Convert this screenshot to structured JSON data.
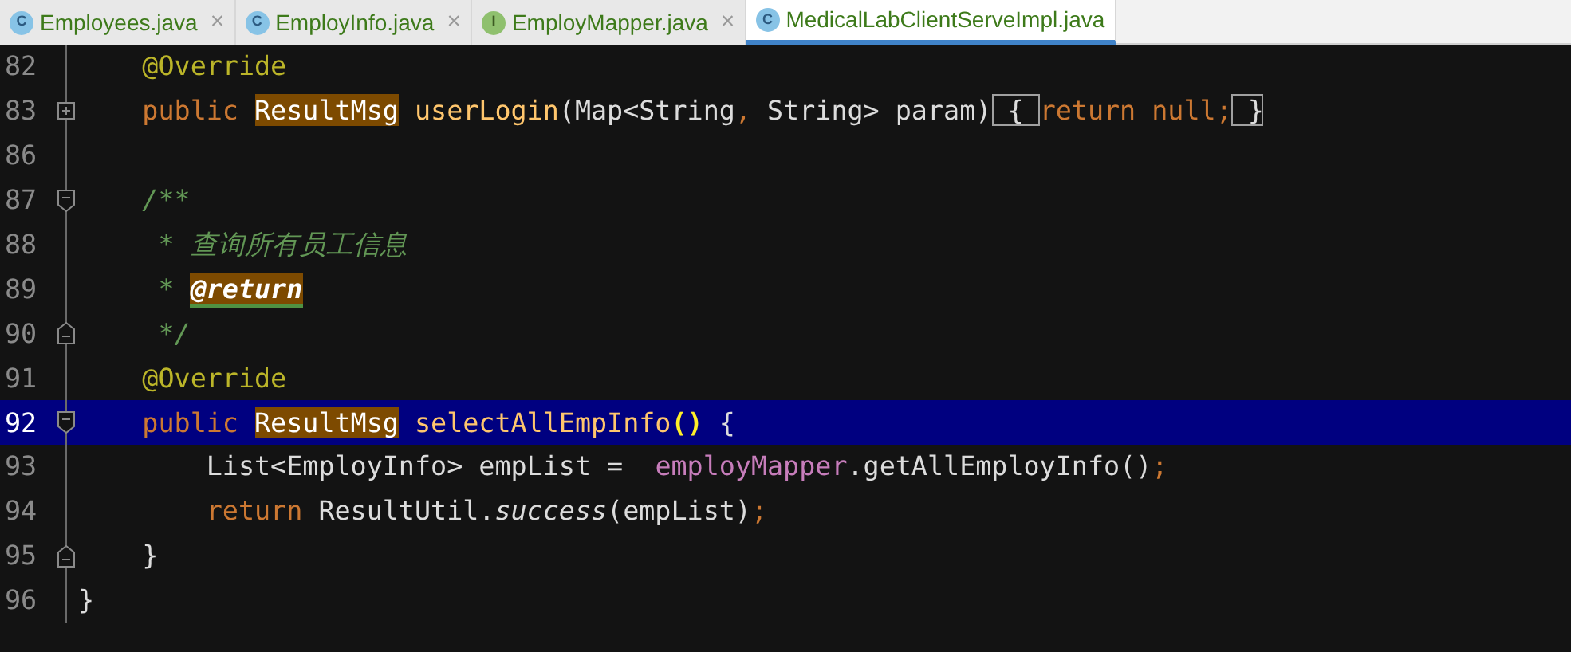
{
  "tabs": [
    {
      "label": "Employees.java",
      "badge": "C",
      "kind": "class",
      "close": "×",
      "selected": false
    },
    {
      "label": "EmployInfo.java",
      "badge": "C",
      "kind": "class",
      "close": "×",
      "selected": false
    },
    {
      "label": "EmployMapper.java",
      "badge": "I",
      "kind": "interface",
      "close": "×",
      "selected": false
    },
    {
      "label": "MedicalLabClientServeImpl.java",
      "badge": "C",
      "kind": "class",
      "selected": true
    }
  ],
  "lines": [
    {
      "number": "82",
      "current": false,
      "tokens": [
        {
          "text": "    @Override",
          "kind": "annotation"
        }
      ]
    },
    {
      "number": "83",
      "current": false,
      "fold": {
        "collapsed": true
      },
      "tokens": [
        {
          "text": "    public ",
          "kind": "keyword"
        },
        {
          "text": "ResultMsg",
          "kind": "type-highlighted"
        },
        {
          "text": " userLogin",
          "kind": "method"
        },
        {
          "text": "(Map<String"
        },
        {
          "text": ",",
          "kind": "keyword"
        },
        {
          "text": " String> param)"
        },
        {
          "text": " { ",
          "kind": "brace-matched"
        },
        {
          "text": "return null;",
          "kind": "keyword"
        },
        {
          "text": " }",
          "kind": "brace-matched"
        }
      ]
    },
    {
      "number": "86",
      "current": false
    },
    {
      "number": "87",
      "current": false,
      "fold": {
        "collapsed": false,
        "end": false
      },
      "tokens": [
        {
          "text": "    /**",
          "kind": "comment"
        }
      ]
    },
    {
      "number": "88",
      "current": false,
      "tokens": [
        {
          "text": "     * 查询所有员工信息",
          "kind": "comment"
        }
      ]
    },
    {
      "number": "89",
      "current": false,
      "tokens": [
        {
          "text": "     * ",
          "kind": "comment"
        },
        {
          "text": "@return",
          "kind": "doc-tag-highlighted"
        }
      ]
    },
    {
      "number": "90",
      "current": false,
      "fold": {
        "collapsed": false,
        "end": true
      },
      "tokens": [
        {
          "text": "     */",
          "kind": "comment"
        }
      ]
    },
    {
      "number": "91",
      "current": false,
      "tokens": [
        {
          "text": "    @Override",
          "kind": "annotation"
        }
      ]
    },
    {
      "number": "92",
      "current": true,
      "fold": {
        "collapsed": false,
        "end": false
      },
      "tokens": [
        {
          "text": "    public ",
          "kind": "keyword"
        },
        {
          "text": "ResultMsg",
          "kind": "type-highlighted"
        },
        {
          "text": " selectAllEmpInfo",
          "kind": "method"
        },
        {
          "text": "()",
          "kind": "paren-matched"
        },
        {
          "text": " {"
        }
      ]
    },
    {
      "number": "93",
      "current": false,
      "tokens": [
        {
          "text": "        List<EmployInfo> empList =  "
        },
        {
          "text": "employMapper",
          "kind": "field"
        },
        {
          "text": ".getAllEmployInfo()"
        },
        {
          "text": ";",
          "kind": "keyword"
        }
      ]
    },
    {
      "number": "94",
      "current": false,
      "tokens": [
        {
          "text": "        return ",
          "kind": "keyword"
        },
        {
          "text": "ResultUtil."
        },
        {
          "text": "success",
          "kind": "static-call"
        },
        {
          "text": "(empList)"
        },
        {
          "text": ";",
          "kind": "keyword"
        }
      ]
    },
    {
      "number": "95",
      "current": false,
      "fold": {
        "collapsed": false,
        "end": true
      },
      "tokens": [
        {
          "text": "    }"
        }
      ]
    },
    {
      "number": "96",
      "current": false,
      "tokens": [
        {
          "text": "}"
        }
      ]
    }
  ]
}
